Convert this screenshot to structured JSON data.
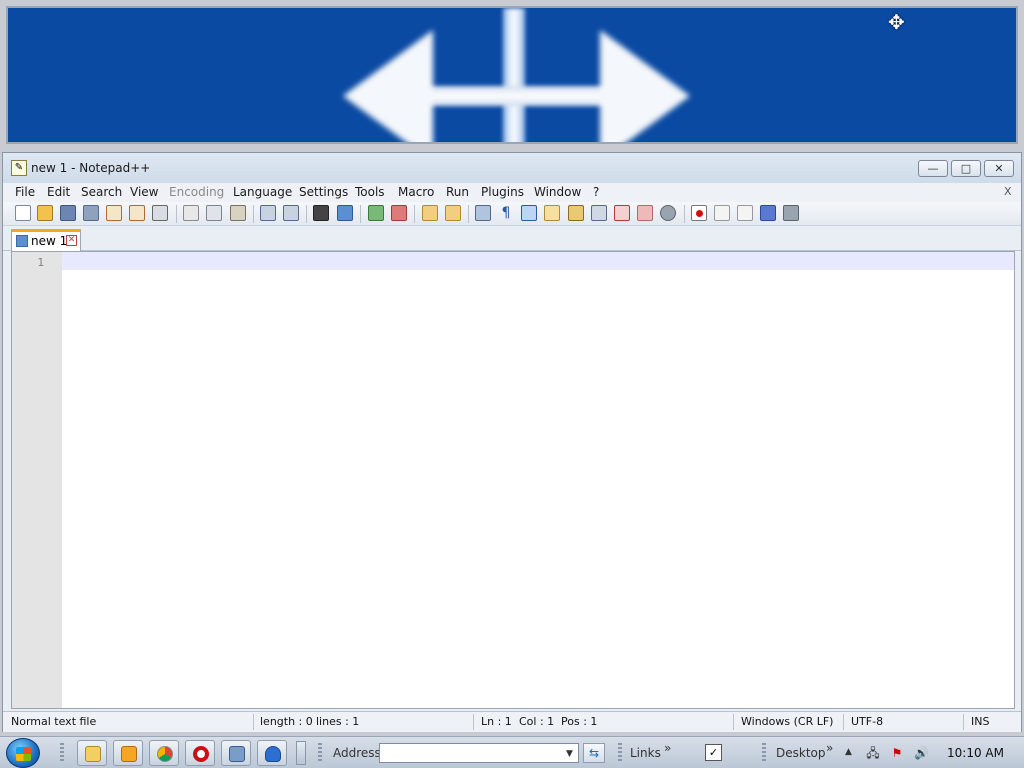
{
  "magnifier": {
    "cursor_icon": "move-cursor-icon"
  },
  "window": {
    "title": "new 1 - Notepad++",
    "min_label": "—",
    "max_label": "□",
    "close_label": "✕"
  },
  "menu": {
    "items": [
      "File",
      "Edit",
      "Search",
      "View",
      "Encoding",
      "Language",
      "Settings",
      "Tools",
      "Macro",
      "Run",
      "Plugins",
      "Window",
      "?"
    ],
    "close_doc": "X"
  },
  "tab": {
    "label": "new 1",
    "close": "✕"
  },
  "editor": {
    "line_number": "1"
  },
  "status": {
    "file_type": "Normal text file",
    "length": "length : 0",
    "lines": "lines : 1",
    "ln": "Ln : 1",
    "col": "Col : 1",
    "pos": "Pos : 1",
    "eol": "Windows (CR LF)",
    "encoding": "UTF-8",
    "mode": "INS"
  },
  "taskbar": {
    "address_label": "Address",
    "links_label": "Links",
    "links_more": "»",
    "desktop_label": "Desktop",
    "desktop_more": "»",
    "clock": "10:10 AM"
  },
  "colors": {
    "magnifier_bg": "#0b4aa3",
    "current_line": "#e8e8ff",
    "tab_accent": "#f5a623"
  }
}
